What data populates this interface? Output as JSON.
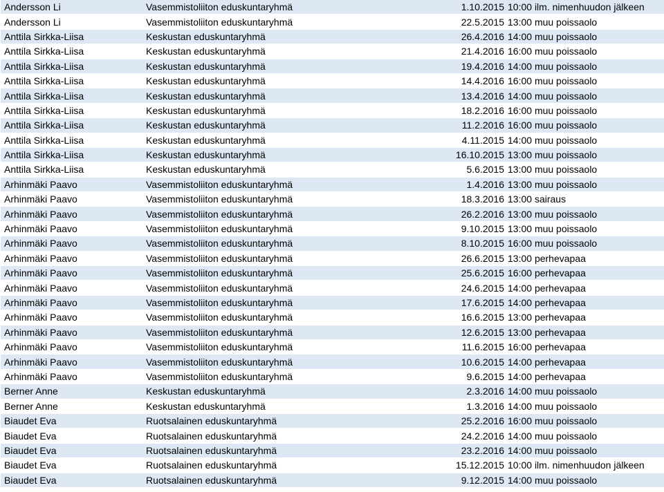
{
  "rows": [
    {
      "name": "Andersson Li",
      "group": "Vasemmistoliiton eduskuntaryhmä",
      "date": "1.10.2015",
      "time": "10:00",
      "reason": "ilm. nimenhuudon jälkeen"
    },
    {
      "name": "Andersson Li",
      "group": "Vasemmistoliiton eduskuntaryhmä",
      "date": "22.5.2015",
      "time": "13:00",
      "reason": "muu poissaolo"
    },
    {
      "name": "Anttila Sirkka-Liisa",
      "group": "Keskustan eduskuntaryhmä",
      "date": "26.4.2016",
      "time": "14:00",
      "reason": "muu poissaolo"
    },
    {
      "name": "Anttila Sirkka-Liisa",
      "group": "Keskustan eduskuntaryhmä",
      "date": "21.4.2016",
      "time": "16:00",
      "reason": "muu poissaolo"
    },
    {
      "name": "Anttila Sirkka-Liisa",
      "group": "Keskustan eduskuntaryhmä",
      "date": "19.4.2016",
      "time": "14:00",
      "reason": "muu poissaolo"
    },
    {
      "name": "Anttila Sirkka-Liisa",
      "group": "Keskustan eduskuntaryhmä",
      "date": "14.4.2016",
      "time": "16:00",
      "reason": "muu poissaolo"
    },
    {
      "name": "Anttila Sirkka-Liisa",
      "group": "Keskustan eduskuntaryhmä",
      "date": "13.4.2016",
      "time": "14:00",
      "reason": "muu poissaolo"
    },
    {
      "name": "Anttila Sirkka-Liisa",
      "group": "Keskustan eduskuntaryhmä",
      "date": "18.2.2016",
      "time": "16:00",
      "reason": "muu poissaolo"
    },
    {
      "name": "Anttila Sirkka-Liisa",
      "group": "Keskustan eduskuntaryhmä",
      "date": "11.2.2016",
      "time": "16:00",
      "reason": "muu poissaolo"
    },
    {
      "name": "Anttila Sirkka-Liisa",
      "group": "Keskustan eduskuntaryhmä",
      "date": "4.11.2015",
      "time": "14:00",
      "reason": "muu poissaolo"
    },
    {
      "name": "Anttila Sirkka-Liisa",
      "group": "Keskustan eduskuntaryhmä",
      "date": "16.10.2015",
      "time": "13:00",
      "reason": "muu poissaolo"
    },
    {
      "name": "Anttila Sirkka-Liisa",
      "group": "Keskustan eduskuntaryhmä",
      "date": "5.6.2015",
      "time": "13:00",
      "reason": "muu poissaolo"
    },
    {
      "name": "Arhinmäki Paavo",
      "group": "Vasemmistoliiton eduskuntaryhmä",
      "date": "1.4.2016",
      "time": "13:00",
      "reason": "muu poissaolo"
    },
    {
      "name": "Arhinmäki Paavo",
      "group": "Vasemmistoliiton eduskuntaryhmä",
      "date": "18.3.2016",
      "time": "13:00",
      "reason": "sairaus"
    },
    {
      "name": "Arhinmäki Paavo",
      "group": "Vasemmistoliiton eduskuntaryhmä",
      "date": "26.2.2016",
      "time": "13:00",
      "reason": "muu poissaolo"
    },
    {
      "name": "Arhinmäki Paavo",
      "group": "Vasemmistoliiton eduskuntaryhmä",
      "date": "9.10.2015",
      "time": "13:00",
      "reason": "muu poissaolo"
    },
    {
      "name": "Arhinmäki Paavo",
      "group": "Vasemmistoliiton eduskuntaryhmä",
      "date": "8.10.2015",
      "time": "16:00",
      "reason": "muu poissaolo"
    },
    {
      "name": "Arhinmäki Paavo",
      "group": "Vasemmistoliiton eduskuntaryhmä",
      "date": "26.6.2015",
      "time": "13:00",
      "reason": "perhevapaa"
    },
    {
      "name": "Arhinmäki Paavo",
      "group": "Vasemmistoliiton eduskuntaryhmä",
      "date": "25.6.2015",
      "time": "16:00",
      "reason": "perhevapaa"
    },
    {
      "name": "Arhinmäki Paavo",
      "group": "Vasemmistoliiton eduskuntaryhmä",
      "date": "24.6.2015",
      "time": "14:00",
      "reason": "perhevapaa"
    },
    {
      "name": "Arhinmäki Paavo",
      "group": "Vasemmistoliiton eduskuntaryhmä",
      "date": "17.6.2015",
      "time": "14:00",
      "reason": "perhevapaa"
    },
    {
      "name": "Arhinmäki Paavo",
      "group": "Vasemmistoliiton eduskuntaryhmä",
      "date": "16.6.2015",
      "time": "13:00",
      "reason": "perhevapaa"
    },
    {
      "name": "Arhinmäki Paavo",
      "group": "Vasemmistoliiton eduskuntaryhmä",
      "date": "12.6.2015",
      "time": "13:00",
      "reason": "perhevapaa"
    },
    {
      "name": "Arhinmäki Paavo",
      "group": "Vasemmistoliiton eduskuntaryhmä",
      "date": "11.6.2015",
      "time": "16:00",
      "reason": "perhevapaa"
    },
    {
      "name": "Arhinmäki Paavo",
      "group": "Vasemmistoliiton eduskuntaryhmä",
      "date": "10.6.2015",
      "time": "14:00",
      "reason": "perhevapaa"
    },
    {
      "name": "Arhinmäki Paavo",
      "group": "Vasemmistoliiton eduskuntaryhmä",
      "date": "9.6.2015",
      "time": "14:00",
      "reason": "perhevapaa"
    },
    {
      "name": "Berner Anne",
      "group": "Keskustan eduskuntaryhmä",
      "date": "2.3.2016",
      "time": "14:00",
      "reason": "muu poissaolo"
    },
    {
      "name": "Berner Anne",
      "group": "Keskustan eduskuntaryhmä",
      "date": "1.3.2016",
      "time": "14:00",
      "reason": "muu poissaolo"
    },
    {
      "name": "Biaudet Eva",
      "group": "Ruotsalainen eduskuntaryhmä",
      "date": "25.2.2016",
      "time": "16:00",
      "reason": "muu poissaolo"
    },
    {
      "name": "Biaudet Eva",
      "group": "Ruotsalainen eduskuntaryhmä",
      "date": "24.2.2016",
      "time": "14:00",
      "reason": "muu poissaolo"
    },
    {
      "name": "Biaudet Eva",
      "group": "Ruotsalainen eduskuntaryhmä",
      "date": "23.2.2016",
      "time": "14:00",
      "reason": "muu poissaolo"
    },
    {
      "name": "Biaudet Eva",
      "group": "Ruotsalainen eduskuntaryhmä",
      "date": "15.12.2015",
      "time": "10:00",
      "reason": "ilm. nimenhuudon jälkeen"
    },
    {
      "name": "Biaudet Eva",
      "group": "Ruotsalainen eduskuntaryhmä",
      "date": "9.12.2015",
      "time": "14:00",
      "reason": "muu poissaolo"
    }
  ]
}
